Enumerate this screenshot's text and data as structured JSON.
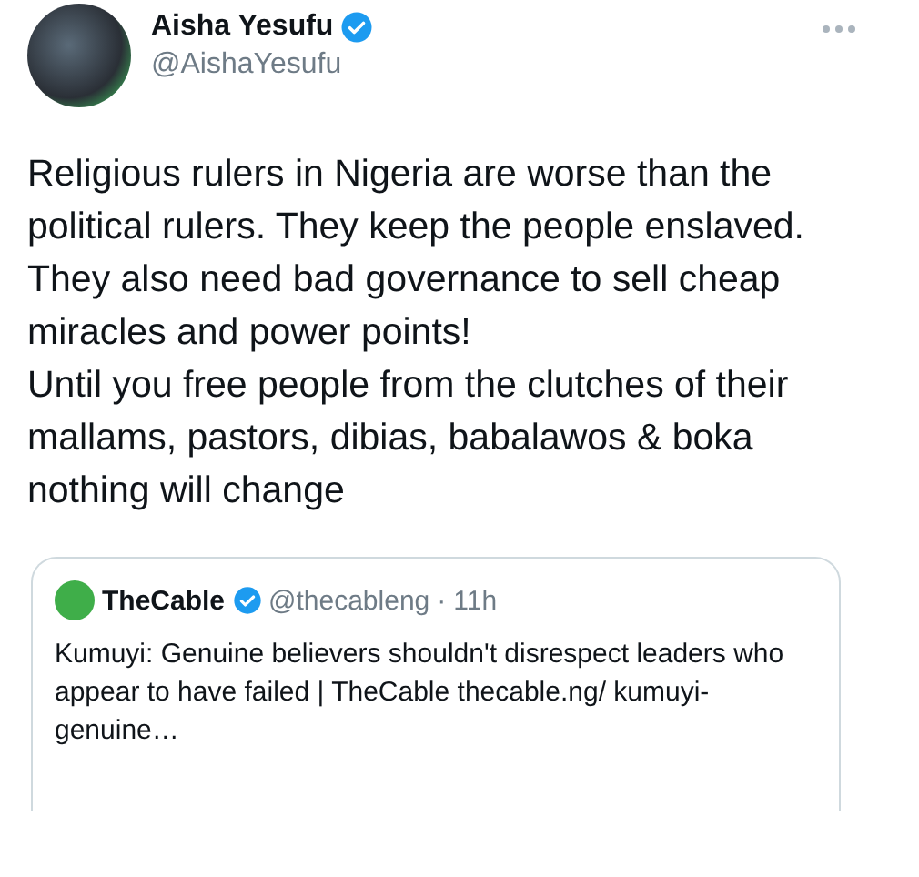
{
  "author": {
    "name": "Aisha Yesufu",
    "handle": "@AishaYesufu",
    "verified": true
  },
  "paragraphs": [
    "Religious rulers in Nigeria are worse than the political rulers. They keep the people enslaved.",
    "They also need bad governance to sell cheap miracles and power points!",
    "Until you free people from the clutches of their mallams, pastors, dibias, babalawos & boka nothing will change"
  ],
  "quote": {
    "name": "TheCable",
    "verified": true,
    "handle": "@thecableng",
    "separator": "·",
    "time": "11h",
    "text": "Kumuyi: Genuine believers shouldn't disrespect leaders who appear to have failed | TheCable thecable.ng/ kumuyi-genuine…"
  }
}
